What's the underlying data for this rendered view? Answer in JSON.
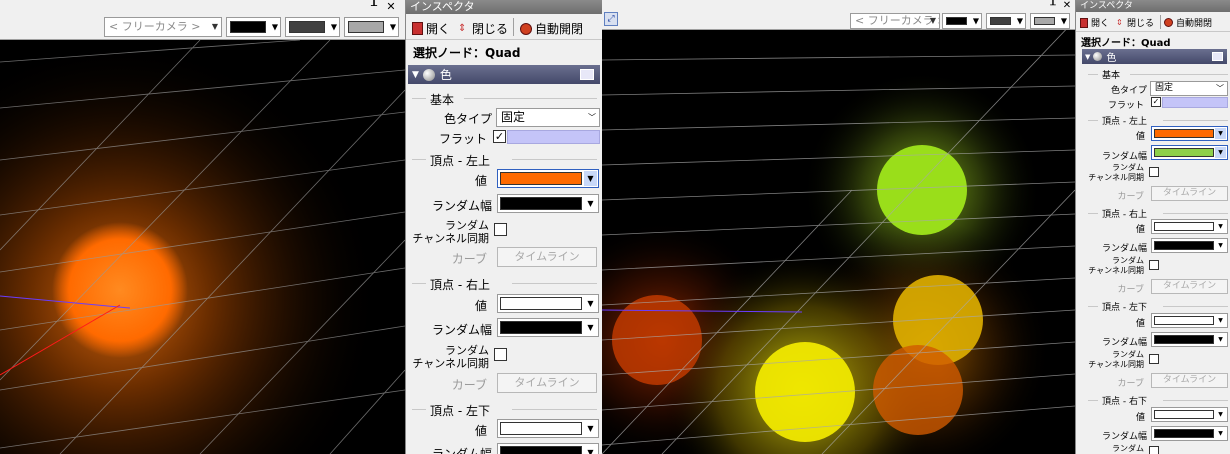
{
  "left_viewport": {
    "camera_select": "< フリーカメラ >",
    "colors": [
      "#000000",
      "#404040",
      "#a8a8a8"
    ],
    "pin_icon": "pin-icon",
    "close_label": "✕"
  },
  "left_inspector": {
    "title": "インスペクタ",
    "toolbar": {
      "open": "開く",
      "close": "閉じる",
      "auto": "自動開閉"
    },
    "selected_node": "選択ノード：Quad",
    "section_title": "色",
    "basic_group": "基本",
    "color_type_label": "色タイプ",
    "color_type_value": "固定",
    "flat_label": "フラット",
    "vertices": [
      {
        "group": "頂点 - 左上",
        "value_label": "値",
        "value_color": "#ff6a00",
        "random_label": "ランダム幅",
        "random_color": "#000000",
        "sync_label_1": "ランダム",
        "sync_label_2": "チャンネル同期",
        "curve_label": "カーブ",
        "timeline_label": "タイムライン"
      },
      {
        "group": "頂点 - 右上",
        "value_label": "値",
        "value_color": "#ffffff",
        "random_label": "ランダム幅",
        "random_color": "#000000",
        "sync_label_1": "ランダム",
        "sync_label_2": "チャンネル同期",
        "curve_label": "カーブ",
        "timeline_label": "タイムライン"
      },
      {
        "group": "頂点 - 左下",
        "value_label": "値",
        "value_color": "#ffffff",
        "random_label": "ランダム幅",
        "random_color": "#000000"
      }
    ]
  },
  "right_viewport": {
    "camera_select": "< フリーカメラ >",
    "colors": [
      "#000000",
      "#404040",
      "#a8a8a8"
    ],
    "close_label": "✕"
  },
  "right_inspector": {
    "title": "インスペクタ",
    "toolbar": {
      "open": "開く",
      "close": "閉じる",
      "auto": "自動開閉"
    },
    "selected_node": "選択ノード：Quad",
    "section_title": "色",
    "basic_group": "基本",
    "color_type_label": "色タイプ",
    "color_type_value": "固定",
    "flat_label": "フラット",
    "vertices": [
      {
        "group": "頂点 - 左上",
        "value_label": "値",
        "value_color": "#ff6a00",
        "random_label": "ランダム幅",
        "random_color": "#8ed04a",
        "sync_label_1": "ランダム",
        "sync_label_2": "チャンネル同期",
        "curve_label": "カーブ",
        "timeline_label": "タイムライン"
      },
      {
        "group": "頂点 - 右上",
        "value_label": "値",
        "value_color": "#ffffff",
        "random_label": "ランダム幅",
        "random_color": "#000000",
        "sync_label_1": "ランダム",
        "sync_label_2": "チャンネル同期",
        "curve_label": "カーブ",
        "timeline_label": "タイムライン"
      },
      {
        "group": "頂点 - 左下",
        "value_label": "値",
        "value_color": "#ffffff",
        "random_label": "ランダム幅",
        "random_color": "#000000",
        "sync_label_1": "ランダム",
        "sync_label_2": "チャンネル同期",
        "curve_label": "カーブ",
        "timeline_label": "タイムライン"
      },
      {
        "group": "頂点 - 右下",
        "value_label": "値",
        "value_color": "#ffffff",
        "random_label": "ランダム幅",
        "random_color": "#000000",
        "sync_label_1": "ランダム"
      }
    ]
  }
}
